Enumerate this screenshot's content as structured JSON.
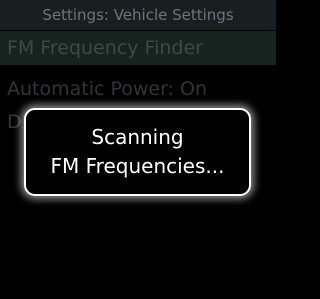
{
  "header": {
    "title": "Settings: Vehicle Settings"
  },
  "menu": {
    "items": [
      {
        "label": "FM Frequency Finder",
        "selected": true
      },
      {
        "label": "Automatic Power: On",
        "selected": false
      },
      {
        "label": "D",
        "selected": false
      }
    ]
  },
  "dialog": {
    "line1": "Scanning",
    "line2": "FM Frequencies..."
  },
  "colors": {
    "background": "#000000",
    "header_bg": "#1d2527",
    "selected_bg": "#1a2b26",
    "dialog_border": "#ffffff",
    "text": "#ffffff"
  }
}
